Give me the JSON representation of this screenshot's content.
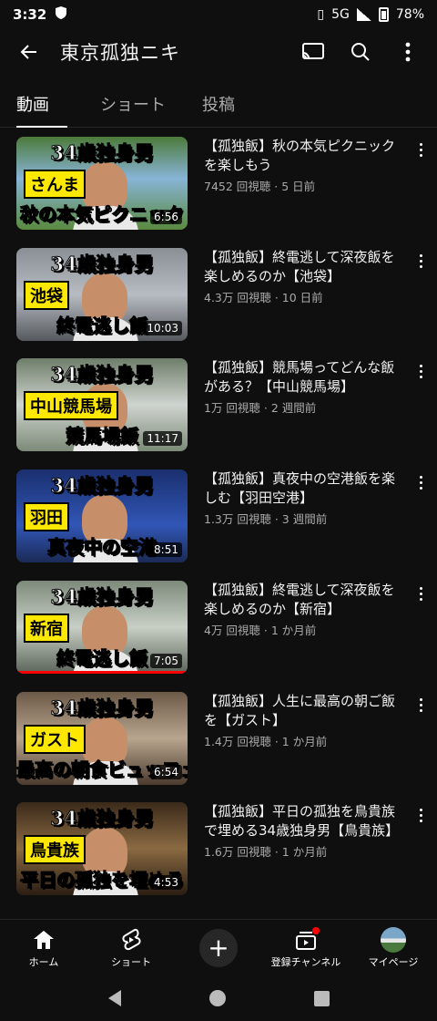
{
  "status": {
    "time": "3:32",
    "network": "5G",
    "battery": "78%"
  },
  "header": {
    "title": "東京孤独ニキ",
    "cast_icon": "cast-icon",
    "search_icon": "search-icon",
    "menu_icon": "more-vert-icon"
  },
  "tabs": [
    {
      "label": "動画",
      "active": true
    },
    {
      "label": "ショート",
      "active": false
    },
    {
      "label": "投稿",
      "active": false
    }
  ],
  "videos": [
    {
      "title": "【孤独飯】秋の本気ピクニックを楽しもう",
      "meta": "7452 回視聴 · 5 日前",
      "duration": "6:56",
      "thumb_headline": "34歳独身男",
      "thumb_caption": "秋の本気ピクニック",
      "thumb_tag": "さんま",
      "watched_fraction": 0
    },
    {
      "title": "【孤独飯】終電逃して深夜飯を楽しめるのか【池袋】",
      "meta": "4.3万 回視聴 · 10 日前",
      "duration": "10:03",
      "thumb_headline": "34歳独身男",
      "thumb_caption": "終電逃し飯",
      "thumb_tag": "池袋",
      "watched_fraction": 0
    },
    {
      "title": "【孤独飯】競馬場ってどんな飯がある？【中山競馬場】",
      "meta": "1万 回視聴 · 2 週間前",
      "duration": "11:17",
      "thumb_headline": "34歳独身男",
      "thumb_caption": "競馬場飯",
      "thumb_tag": "中山競馬場",
      "watched_fraction": 0
    },
    {
      "title": "【孤独飯】真夜中の空港飯を楽しむ【羽田空港】",
      "meta": "1.3万 回視聴 · 3 週間前",
      "duration": "8:51",
      "thumb_headline": "34歳独身男",
      "thumb_caption": "真夜中の空港",
      "thumb_tag": "羽田",
      "watched_fraction": 0
    },
    {
      "title": "【孤独飯】終電逃して深夜飯を楽しめるのか【新宿】",
      "meta": "4万 回視聴 · 1 か月前",
      "duration": "7:05",
      "thumb_headline": "34歳独身男",
      "thumb_caption": "終電逃し飯",
      "thumb_tag": "新宿",
      "watched_fraction": 1
    },
    {
      "title": "【孤独飯】人生に最高の朝ご飯を【ガスト】",
      "meta": "1.4万 回視聴 · 1 か月前",
      "duration": "6:54",
      "thumb_headline": "34歳独身男",
      "thumb_caption": "最高の朝食ビュッフェ",
      "thumb_tag": "ガスト",
      "watched_fraction": 0
    },
    {
      "title": "【孤独飯】平日の孤独を鳥貴族で埋める34歳独身男【鳥貴族】",
      "meta": "1.6万 回視聴 · 1 か月前",
      "duration": "4:53",
      "thumb_headline": "34歳独身男",
      "thumb_caption": "平日の孤独を埋める",
      "thumb_tag": "鳥貴族",
      "watched_fraction": 0
    }
  ],
  "bottom_nav": [
    {
      "label": "ホーム",
      "icon": "home-icon"
    },
    {
      "label": "ショート",
      "icon": "shorts-icon"
    },
    {
      "label": "",
      "icon": "create-plus-icon"
    },
    {
      "label": "登録チャンネル",
      "icon": "subscriptions-icon"
    },
    {
      "label": "マイページ",
      "icon": "avatar"
    }
  ],
  "colors": {
    "background": "#0f0f0f",
    "text": "#f1f1f1",
    "meta": "#aaaaaa",
    "accent": "#ff0000",
    "tag": "#ffe800"
  }
}
